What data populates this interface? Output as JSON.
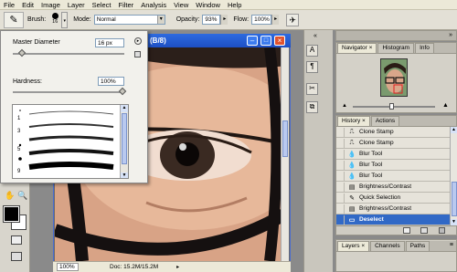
{
  "menu": [
    "File",
    "Edit",
    "Image",
    "Layer",
    "Select",
    "Filter",
    "Analysis",
    "View",
    "Window",
    "Help"
  ],
  "options": {
    "brush_label": "Brush:",
    "brush_size": "16",
    "mode_label": "Mode:",
    "mode_value": "Normal",
    "opacity_label": "Opacity:",
    "opacity_value": "93%",
    "flow_label": "Flow:",
    "flow_value": "100%"
  },
  "brush_popup": {
    "master_diameter_label": "Master Diameter",
    "master_diameter_value": "16 px",
    "hardness_label": "Hardness:",
    "hardness_value": "100%",
    "preset_numbers": [
      "1",
      "3",
      "5",
      "9"
    ]
  },
  "document": {
    "title_suffix": "(B/8)",
    "zoom": "100%",
    "doc_info": "Doc: 15.2M/15.2M"
  },
  "navigator": {
    "tabs": [
      "Navigator",
      "Histogram",
      "Info"
    ]
  },
  "history": {
    "tabs": [
      "History",
      "Actions"
    ],
    "items": [
      {
        "label": "Clone Stamp",
        "icon": "stamp-icon"
      },
      {
        "label": "Clone Stamp",
        "icon": "stamp-icon"
      },
      {
        "label": "Blur Tool",
        "icon": "drop-icon"
      },
      {
        "label": "Blur Tool",
        "icon": "drop-icon"
      },
      {
        "label": "Blur Tool",
        "icon": "drop-icon"
      },
      {
        "label": "Brightness/Contrast",
        "icon": "adjust-icon"
      },
      {
        "label": "Quick Selection",
        "icon": "selection-icon"
      },
      {
        "label": "Brightness/Contrast",
        "icon": "adjust-icon"
      },
      {
        "label": "Deselect",
        "icon": "deselect-icon"
      }
    ],
    "selected_index": 8
  },
  "layers": {
    "tabs": [
      "Layers",
      "Channels",
      "Paths"
    ]
  },
  "colors": {
    "accent": "#3169c6",
    "titlebar": "#2d6be0"
  }
}
